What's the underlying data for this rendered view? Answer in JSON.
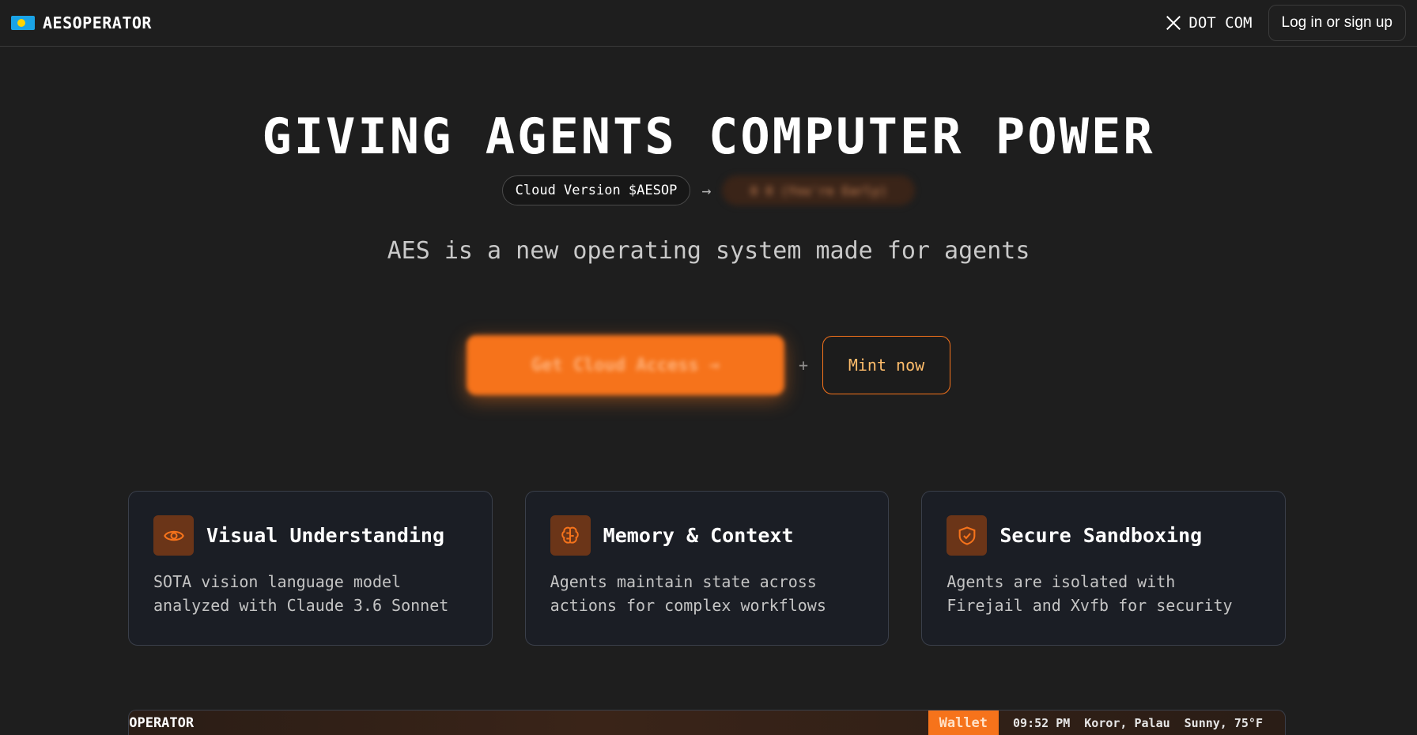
{
  "nav": {
    "brand": "AESOPERATOR",
    "x_label": "DOT COM",
    "login_label": "Log in or sign up"
  },
  "hero": {
    "title": "GIVING AGENTS COMPUTER POWER",
    "pill_label": "Cloud Version $AESOP",
    "blurred_pill": "0 0 (You're Early)",
    "subtitle": "AES is a new operating system made for agents"
  },
  "cta": {
    "primary_label": "Get Cloud Access →",
    "separator": "+",
    "mint_label": "Mint now"
  },
  "features": [
    {
      "icon": "eye-icon",
      "title": "Visual Understanding",
      "desc_line1": "SOTA vision language model",
      "desc_line2": "analyzed with Claude 3.6 Sonnet"
    },
    {
      "icon": "brain-icon",
      "title": "Memory & Context",
      "desc_line1": "Agents maintain state across",
      "desc_line2": "actions for complex workflows"
    },
    {
      "icon": "shield-check-icon",
      "title": "Secure Sandboxing",
      "desc_line1": "Agents are isolated with",
      "desc_line2": "Firejail and Xvfb for security"
    }
  ],
  "preview": {
    "brand": "SOPERATOR",
    "wallet_label": "Wallet",
    "time": "09:52 PM",
    "location": "Koror, Palau",
    "weather": "Sunny, 75°F"
  },
  "colors": {
    "accent": "#f6731b",
    "background": "#1e1e1e",
    "card_bg": "#1b1e25",
    "icon_box": "#6b3518"
  }
}
